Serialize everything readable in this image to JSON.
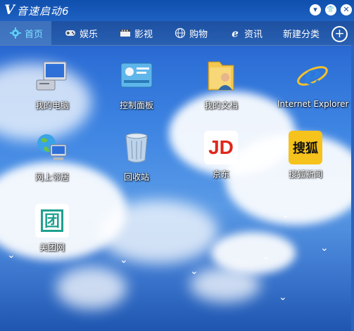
{
  "app": {
    "logo": "V",
    "title": "音速启动6"
  },
  "window_controls": [
    {
      "name": "menu",
      "glyph": "▾"
    },
    {
      "name": "skin",
      "glyph": "👕"
    },
    {
      "name": "close",
      "glyph": "✕"
    }
  ],
  "tabs": [
    {
      "label": "首页",
      "icon": "gear-icon",
      "active": true
    },
    {
      "label": "娱乐",
      "icon": "gamepad-icon"
    },
    {
      "label": "影视",
      "icon": "film-icon"
    },
    {
      "label": "购物",
      "icon": "globe-icon"
    },
    {
      "label": "资讯",
      "icon": "ie-icon"
    },
    {
      "label": "新建分类",
      "icon": ""
    }
  ],
  "add_label": "+",
  "desktop_icons": [
    {
      "label": "我的电脑",
      "icon": "computer-icon"
    },
    {
      "label": "控制面板",
      "icon": "control-panel-icon"
    },
    {
      "label": "我的文档",
      "icon": "documents-folder-icon"
    },
    {
      "label": "Internet Explorer",
      "icon": "ie-icon"
    },
    {
      "label": "网上邻居",
      "icon": "network-icon"
    },
    {
      "label": "回收站",
      "icon": "recycle-bin-icon"
    },
    {
      "label": "京东",
      "icon": "jd-icon",
      "text": "JD"
    },
    {
      "label": "搜狐新闻",
      "icon": "sohu-news-icon",
      "text": "搜狐"
    },
    {
      "label": "美团网",
      "icon": "meituan-icon",
      "text": "团"
    }
  ],
  "colors": {
    "accent": "#7fe0ff",
    "jd_red": "#e1251b",
    "sohu_yellow": "#f6c21c",
    "meituan_teal": "#1fa090"
  }
}
